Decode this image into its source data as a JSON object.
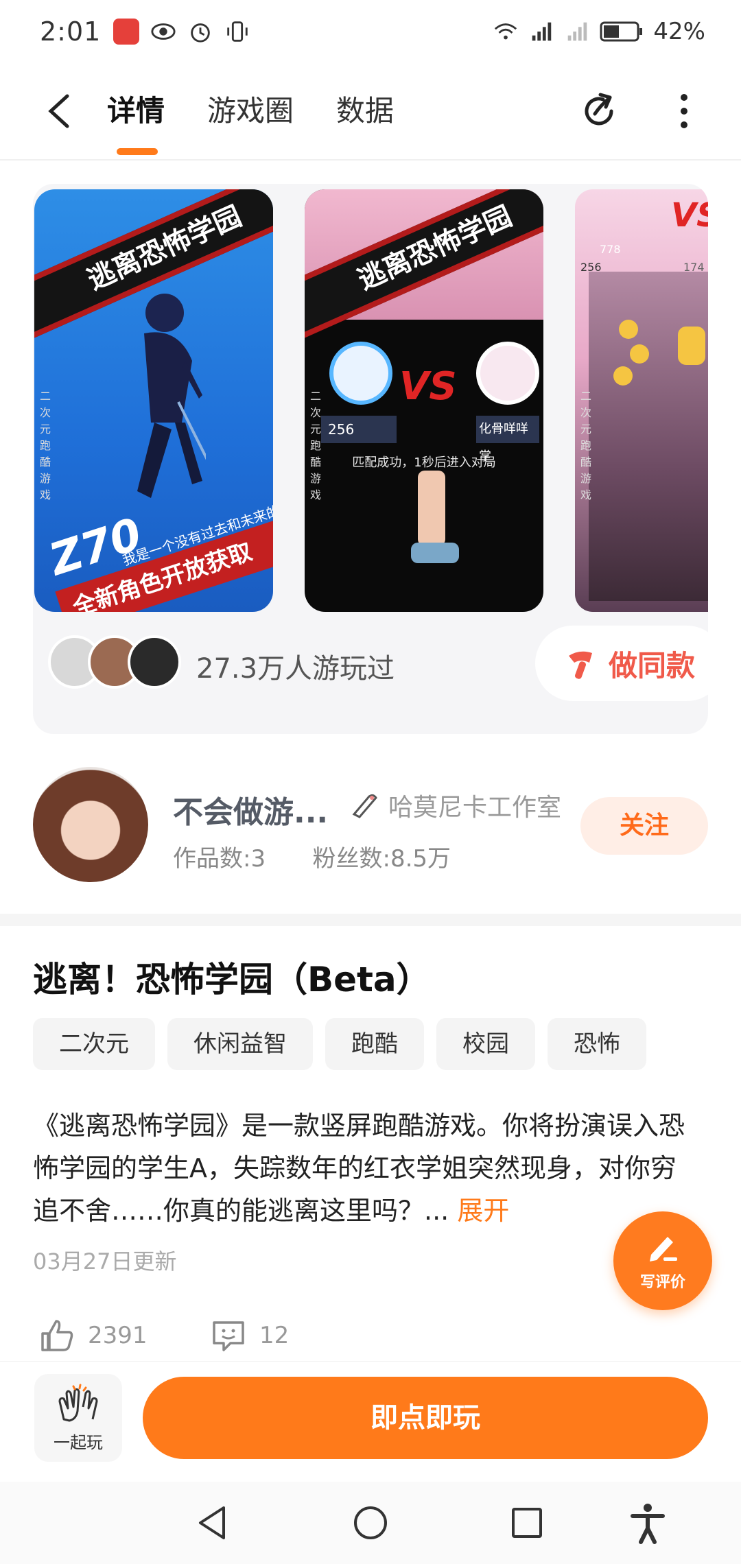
{
  "status_bar": {
    "time": "2:01",
    "battery": "42%",
    "icons": [
      "app-icon",
      "eye-icon",
      "alarm-icon",
      "vibrate-icon",
      "wifi-icon",
      "signal-4g-icon",
      "signal-icon",
      "battery-icon"
    ]
  },
  "nav": {
    "tabs": [
      {
        "label": "详情",
        "active": true
      },
      {
        "label": "游戏圈",
        "active": false
      },
      {
        "label": "数据",
        "active": false
      }
    ]
  },
  "gallery": {
    "shot1": {
      "banner": "逃离恐怖学园",
      "big_text": "Z70",
      "caption": "我是一个没有过去和未来的人。",
      "bottom_banner": "全新角色开放获取",
      "side_text": "二次元跑酷游戏"
    },
    "shot2": {
      "banner": "逃离恐怖学园",
      "vs": "VS",
      "left_name": "256",
      "right_name": "化骨咩咩掌",
      "match_text": "匹配成功，1秒后进入对局",
      "side_text": "二次元跑酷游戏"
    },
    "shot3": {
      "vs": "VS",
      "score_top": "778",
      "score_left": "256",
      "score_right": "174",
      "side_text": "二次元跑酷游戏"
    },
    "played_text": "27.3万人游玩过",
    "make_same_label": "做同款"
  },
  "author": {
    "name": "不会做游...",
    "studio": "哈莫尼卡工作室",
    "works": "作品数:3",
    "fans": "粉丝数:8.5万",
    "follow_label": "关注"
  },
  "game": {
    "title": "逃离！恐怖学园（Beta）",
    "tags": [
      "二次元",
      "休闲益智",
      "跑酷",
      "校园",
      "恐怖"
    ],
    "description": "《逃离恐怖学园》是一款竖屏跑酷游戏。你将扮演误入恐怖学园的学生A，失踪数年的红衣学姐突然现身，对你穷追不舍……你真的能逃离这里吗？...",
    "expand_label": "展开",
    "updated": "03月27日更新",
    "likes": "2391",
    "comments": "12"
  },
  "actions": {
    "write_review": "写评价",
    "together": "一起玩",
    "play": "即点即玩"
  },
  "colors": {
    "accent": "#ff7a1a",
    "follow_bg": "#ffeee6",
    "make_same": "#f05a4a"
  }
}
